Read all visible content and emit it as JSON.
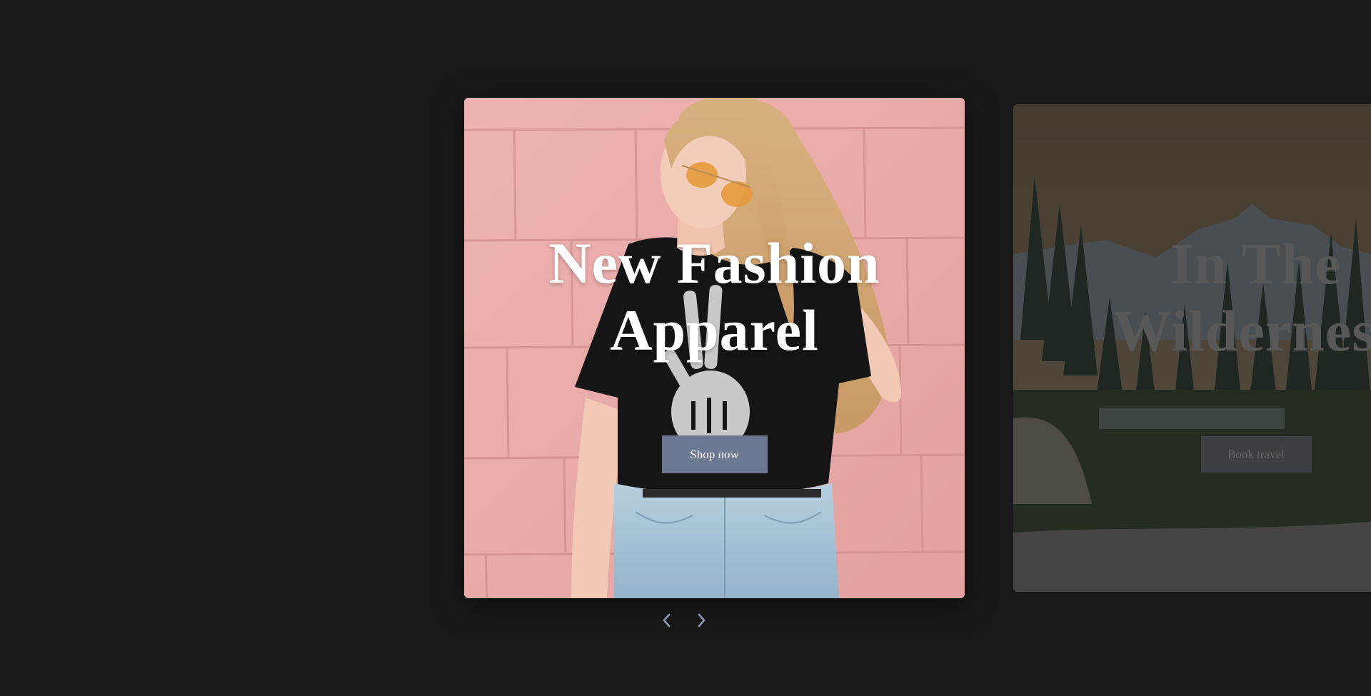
{
  "slides": [
    {
      "title": "New Fashion Apparel",
      "button_label": "Shop now",
      "image": "woman-pink-wall-photo",
      "state": "active"
    },
    {
      "title": "In The Wilderness",
      "button_label": "Book travel",
      "image": "forest-mountain-photo",
      "state": "next"
    }
  ],
  "controls": {
    "previous_icon": "chevron-left-icon",
    "next_icon": "chevron-right-icon"
  },
  "colors": {
    "background": "#19191a",
    "button": "#6c7891",
    "control_arrow": "#8a96ad",
    "pink_wall": "#e9a8a8"
  }
}
